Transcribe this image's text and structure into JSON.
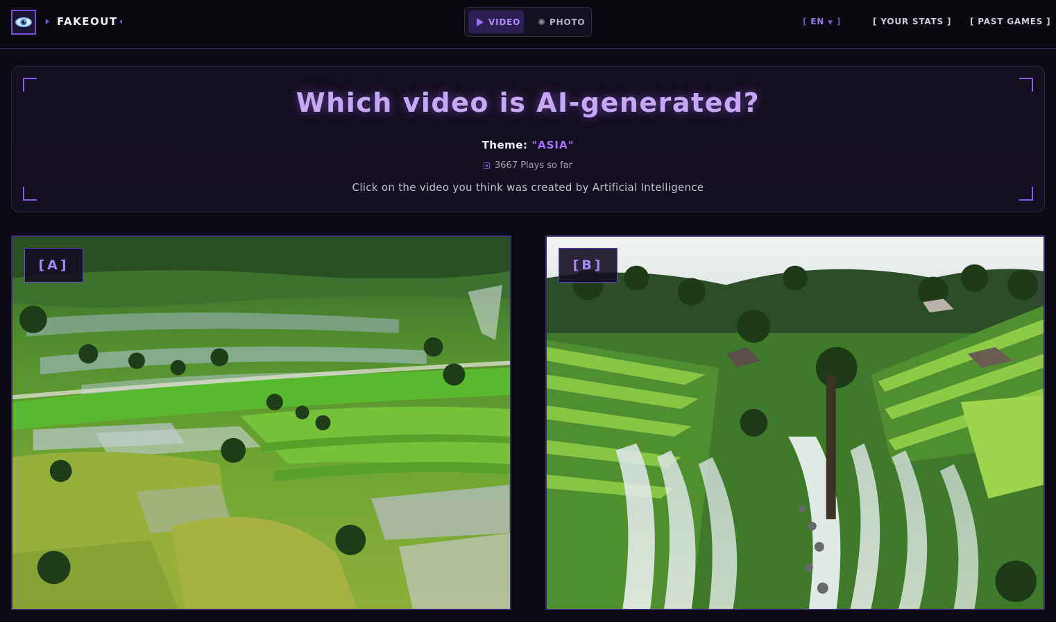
{
  "brand": {
    "name": "FAKEOUT"
  },
  "mode_switch": {
    "video_label": "VIDEO",
    "photo_label": "PHOTO",
    "selected": "VIDEO"
  },
  "nav": {
    "language": "EN",
    "stats_label": "[ YOUR STATS ]",
    "past_games_label": "[ PAST GAMES ]"
  },
  "header": {
    "question": "Which video is AI-generated?",
    "theme_prefix": "Theme:",
    "theme_value": "\"ASIA\"",
    "plays_text": "3667 Plays so far",
    "instruction": "Click on the video you think was created by Artificial Intelligence"
  },
  "cards": [
    {
      "label": "[A]"
    },
    {
      "label": "[B]"
    }
  ],
  "colors": {
    "accent": "#8a5cf0",
    "background": "#0c0a12",
    "headline": "#c6a8f4",
    "theme_value": "#a373ff"
  },
  "icons": {
    "logo": "eye-logo-icon",
    "video_mode": "play-icon",
    "photo_mode": "dot-icon",
    "plays": "square-dot-icon"
  }
}
